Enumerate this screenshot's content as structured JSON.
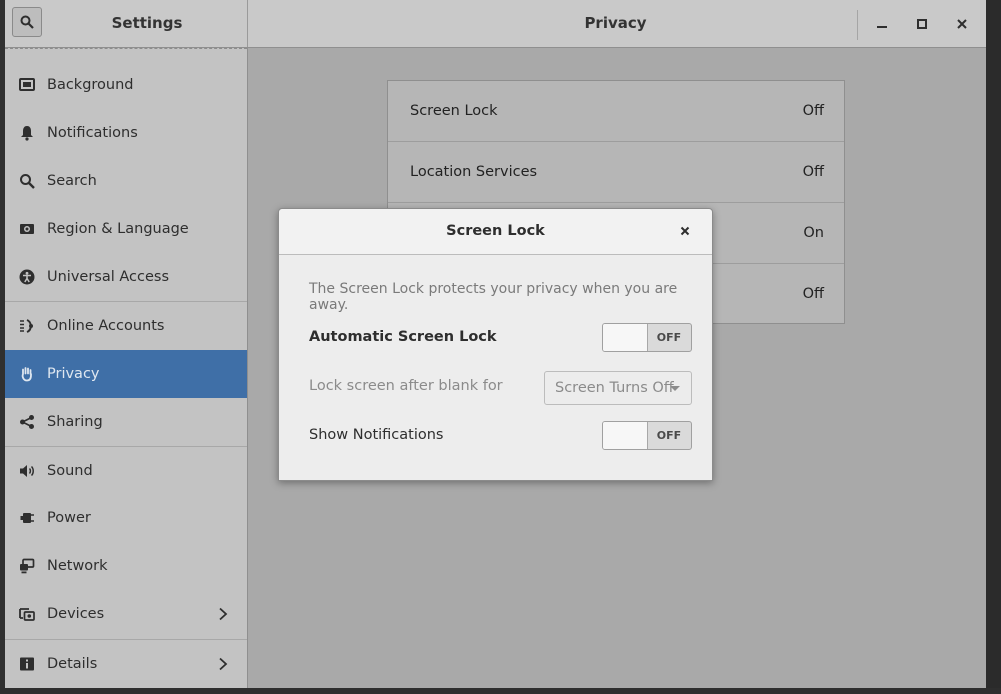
{
  "window": {
    "settings_title": "Settings",
    "panel_title": "Privacy"
  },
  "sidebar": {
    "items": [
      {
        "label": "Background",
        "icon": "background-icon"
      },
      {
        "label": "Notifications",
        "icon": "bell-icon"
      },
      {
        "label": "Search",
        "icon": "search-icon"
      },
      {
        "label": "Region & Language",
        "icon": "region-icon"
      },
      {
        "label": "Universal Access",
        "icon": "accessibility-icon"
      },
      {
        "label": "Online Accounts",
        "icon": "online-accounts-icon"
      },
      {
        "label": "Privacy",
        "icon": "hand-icon",
        "selected": true
      },
      {
        "label": "Sharing",
        "icon": "share-icon"
      },
      {
        "label": "Sound",
        "icon": "speaker-icon"
      },
      {
        "label": "Power",
        "icon": "power-icon"
      },
      {
        "label": "Network",
        "icon": "network-icon"
      },
      {
        "label": "Devices",
        "icon": "devices-icon",
        "has_submenu": true
      },
      {
        "label": "Details",
        "icon": "info-icon",
        "has_submenu": true
      }
    ]
  },
  "privacy": {
    "rows": [
      {
        "label": "Screen Lock",
        "value": "Off"
      },
      {
        "label": "Location Services",
        "value": "Off"
      },
      {
        "label": "",
        "value": "On"
      },
      {
        "label": "",
        "value": "Off"
      }
    ]
  },
  "dialog": {
    "title": "Screen Lock",
    "description": "The Screen Lock protects your privacy when you are away.",
    "auto_lock_label": "Automatic Screen Lock",
    "auto_lock_state": "OFF",
    "lock_after_label": "Lock screen after blank for",
    "lock_after_value": "Screen Turns Off",
    "show_notifications_label": "Show Notifications",
    "show_notifications_state": "OFF"
  },
  "colors": {
    "selection": "#3f6fa7"
  }
}
